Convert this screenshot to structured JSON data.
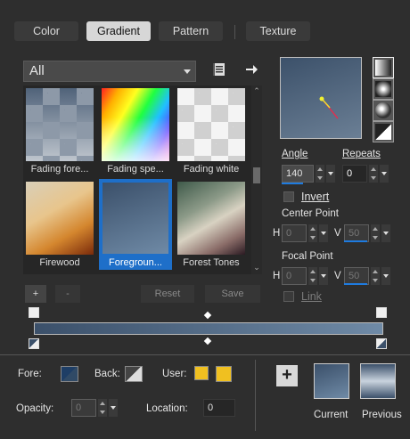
{
  "tabs": [
    "Color",
    "Gradient",
    "Pattern",
    "Texture"
  ],
  "active_tab": "Gradient",
  "category": {
    "selected": "All"
  },
  "gradients": [
    {
      "label": "Fading fore..."
    },
    {
      "label": "Fading spe..."
    },
    {
      "label": "Fading white"
    },
    {
      "label": "Firewood"
    },
    {
      "label": "Foregroun..."
    },
    {
      "label": "Forest Tones"
    }
  ],
  "selected_gradient": "Foregroun...",
  "properties": {
    "angle_label": "Angle",
    "angle_value": "140",
    "repeats_label": "Repeats",
    "repeats_value": "0",
    "invert_label": "Invert",
    "center_label": "Center Point",
    "focal_label": "Focal Point",
    "h_label": "H",
    "v_label": "V",
    "center_h": "0",
    "center_v": "50",
    "focal_h": "0",
    "focal_v": "50",
    "link_label": "Link"
  },
  "buttons": {
    "add": "+",
    "remove": "-",
    "reset": "Reset",
    "save": "Save",
    "add_swatch": "+"
  },
  "bottom": {
    "fore_label": "Fore:",
    "back_label": "Back:",
    "user_label": "User:",
    "opacity_label": "Opacity:",
    "opacity_value": "0",
    "location_label": "Location:",
    "location_value": "0",
    "current_label": "Current",
    "previous_label": "Previous"
  },
  "colors": {
    "accent": "#1e7be0",
    "gradient_start": "#3b506a",
    "gradient_end": "#6f8aa6",
    "user": "#f0c020"
  }
}
